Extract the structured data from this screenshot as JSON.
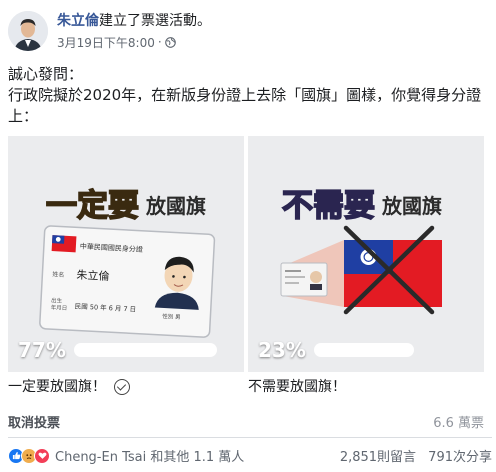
{
  "post": {
    "author": "朱立倫",
    "action": "建立了票選活動。",
    "timestamp": "3月19日下午8:00",
    "separator": "·"
  },
  "question": {
    "line1": "誠心發問：",
    "line2": "行政院擬於2020年，在新版身份證上去除「國旗」圖樣，你覺得身分證",
    "line3": "上："
  },
  "options": [
    {
      "banner_big": "一定要",
      "banner_small": "放國旗",
      "card_title": "中華民國國民身分證",
      "name_label": "姓名",
      "name_value": "朱立倫",
      "dob_label1": "出生",
      "dob_label2": "年月日",
      "dob_value": "民國 50 年 6 月 7 日",
      "sex": "性別 男",
      "percent": "77%",
      "percent_value": 77,
      "label": "一定要放國旗！"
    },
    {
      "banner_big": "不需要",
      "banner_small": "放國旗",
      "percent": "23%",
      "percent_value": 23,
      "label": "不需要放國旗！"
    }
  ],
  "footer": {
    "cancel": "取消投票",
    "votes": "6.6 萬票"
  },
  "reactions": {
    "names": "Cheng-En Tsai 和其他 1.1 萬人",
    "comments": "2,851則留言",
    "shares": "791次分享"
  },
  "colors": {
    "author_blue": "#385898",
    "flag_red": "#e31b23",
    "flag_blue": "#1f3fa3"
  }
}
